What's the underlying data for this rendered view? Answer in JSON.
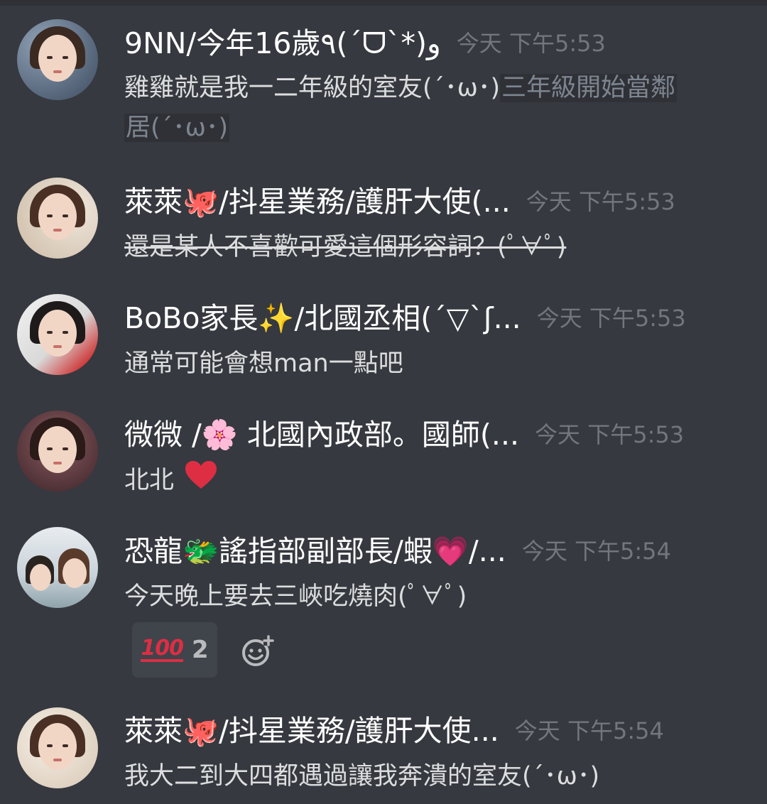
{
  "messages": [
    {
      "username": "9NN/今年16歲٩(ˊᗜˋ*)و",
      "timestamp": "今天 下午5:53",
      "text_plain": "雞雞就是我一二年級的室友(´･ω･)",
      "spoiler_line1": "三年級開始當鄰",
      "spoiler_line2": "居(´･ω･)"
    },
    {
      "username": "萊萊🐙/抖星業務/護肝大使(...",
      "timestamp": "今天 下午5:53",
      "text": "還是某人不喜歡可愛這個形容詞？(ﾟ∀ﾟ)"
    },
    {
      "username": "BoBo家長✨/北國丞相(´▽`ʃ...",
      "timestamp": "今天 下午5:53",
      "text": "通常可能會想man一點吧"
    },
    {
      "username": "微微 /🌸 北國內政部。國師(...",
      "timestamp": "今天 下午5:53",
      "text": "北北",
      "emoji": "❤"
    },
    {
      "username": "恐龍🐲謠指部副部長/蝦💗/...",
      "timestamp": "今天 下午5:54",
      "text": "今天晚上要去三峽吃燒肉(ﾟ∀ﾟ)",
      "reaction": {
        "emoji": "100",
        "count": "2",
        "emoji_name": "hundred-points-icon"
      }
    },
    {
      "username": "萊萊🐙/抖星業務/護肝大使...",
      "timestamp": "今天 下午5:54",
      "text": "我大二到大四都遇過讓我奔潰的室友(´･ω･)"
    }
  ],
  "colors": {
    "background": "#36393f",
    "username": "#ffffff",
    "timestamp": "#72767d",
    "text": "#dcddde",
    "reaction_bg": "#40444b",
    "heart": "#dd2e44"
  }
}
